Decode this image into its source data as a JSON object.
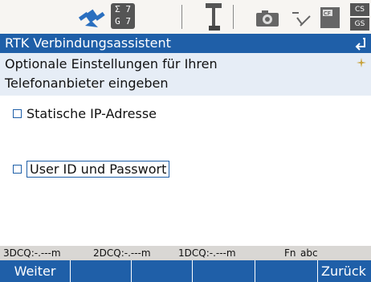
{
  "statusbar": {
    "icons": [
      "satellite-icon",
      "satellite-count-icon",
      "antenna-icon",
      "camera-icon",
      "pen-icon",
      "cf-card-icon",
      "memory-icon"
    ],
    "satellite_counts": {
      "sigma": "Σ",
      "sigma_value": "7",
      "g": "G",
      "g_value": "7"
    },
    "cs_labels": [
      "CS",
      "GS"
    ]
  },
  "titlebar": {
    "title": "RTK Verbindungsassistent"
  },
  "info": {
    "line1": "Optionale Einstellungen für Ihren",
    "line2": "Telefonanbieter eingeben"
  },
  "options": [
    {
      "label": "Statische IP-Adresse",
      "checked": false,
      "focused": false
    },
    {
      "label": "User ID und Passwort",
      "checked": false,
      "focused": true
    }
  ],
  "statusline": {
    "q3d": "3DCQ:-.---m",
    "q2d": "2DCQ:-.---m",
    "q1d": "1DCQ:-.---m",
    "fn": "Fn",
    "mode": "abc"
  },
  "softkeys": {
    "f1": "Weiter",
    "f2": "",
    "f3": "",
    "f4": "",
    "f5": "",
    "f6": "Zurück"
  },
  "colors": {
    "accent": "#1f5fa8",
    "info_bg": "#e6edf6",
    "statusline_bg": "#d9d7d4"
  }
}
